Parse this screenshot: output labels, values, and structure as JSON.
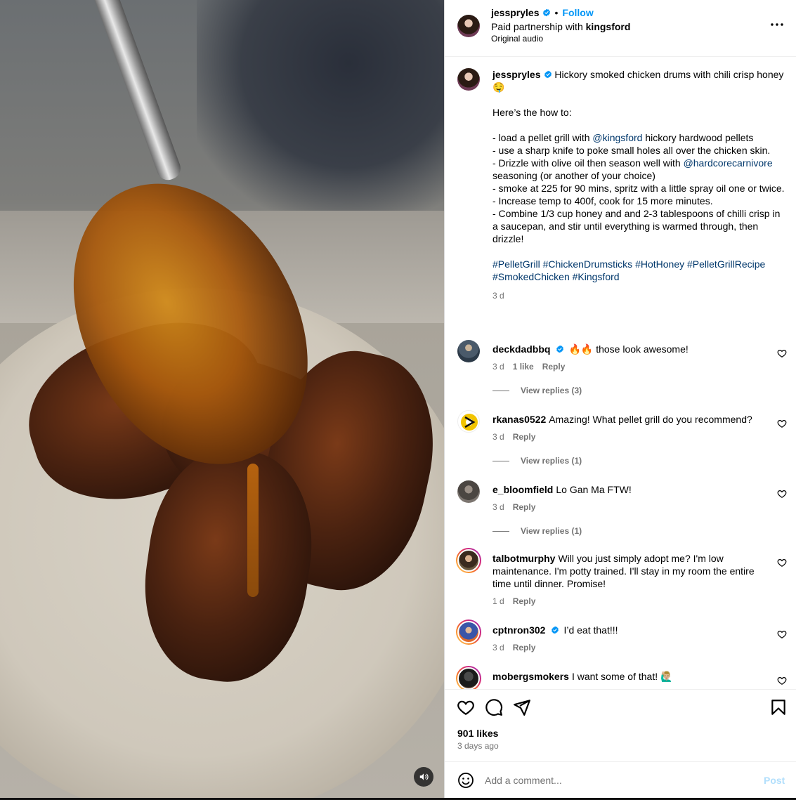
{
  "post": {
    "username": "jesspryles",
    "follow_label": "Follow",
    "partnership_prefix": "Paid partnership with",
    "partner": "kingsford",
    "audio": "Original audio"
  },
  "caption": {
    "username": "jesspryles",
    "line1": "Hickory smoked chicken drums with chili crisp honey 🤤",
    "howto": "Here’s the how to:",
    "step1_pre": "- load a pellet grill with ",
    "step1_mention": "@kingsford",
    "step1_post": " hickory hardwood pellets",
    "step2": "- use a sharp knife to poke small holes all over the chicken skin.",
    "step3_pre": "- Drizzle with olive oil then season well with ",
    "step3_mention": "@hardcorecarnivore",
    "step3_post": " seasoning (or another of your choice)",
    "step4": "- smoke at 225 for 90 mins, spritz with a little spray oil one or twice.",
    "step5": "- Increase temp to 400f, cook for 15 more minutes.",
    "step6": "- Combine 1/3 cup honey and and 2-3 tablespoons of chilli crisp in a saucepan, and stir until everything is warmed through, then drizzle!",
    "hashtags": [
      "#PelletGrill",
      "#ChickenDrumsticks",
      "#HotHoney",
      "#PelletGrillRecipe",
      "#SmokedChicken",
      "#Kingsford"
    ],
    "time": "3 d"
  },
  "comments": [
    {
      "username": "deckdadbbq",
      "text": "🔥🔥 those look awesome!",
      "time": "3 d",
      "likes": "1 like",
      "reply": "Reply",
      "view_replies": "View replies (3)"
    },
    {
      "username": "rkanas0522",
      "text": "Amazing! What pellet grill do you recommend?",
      "time": "3 d",
      "reply": "Reply",
      "view_replies": "View replies (1)"
    },
    {
      "username": "e_bloomfield",
      "text": "Lo Gan Ma FTW!",
      "time": "3 d",
      "reply": "Reply",
      "view_replies": "View replies (1)"
    },
    {
      "username": "talbotmurphy",
      "text": "Will you just simply adopt me? I'm low maintenance. I'm potty trained. I'll stay in my room the entire time until dinner. Promise!",
      "time": "1 d",
      "reply": "Reply"
    },
    {
      "username": "cptnron302",
      "text": "I’d eat that!!!",
      "time": "3 d",
      "reply": "Reply"
    },
    {
      "username": "mobergsmokers",
      "text": "I want some of that! 🙋🏼‍♂️"
    }
  ],
  "footer": {
    "likes": "901 likes",
    "ago": "3 days ago",
    "comment_placeholder": "Add a comment...",
    "post_label": "Post"
  },
  "colors": {
    "link": "#00376b",
    "follow": "#0095f6",
    "muted": "#737373"
  },
  "icons": [
    "verified-badge-icon",
    "more-options-icon",
    "heart-icon",
    "comment-icon",
    "share-icon",
    "bookmark-icon",
    "emoji-icon",
    "sound-icon"
  ]
}
